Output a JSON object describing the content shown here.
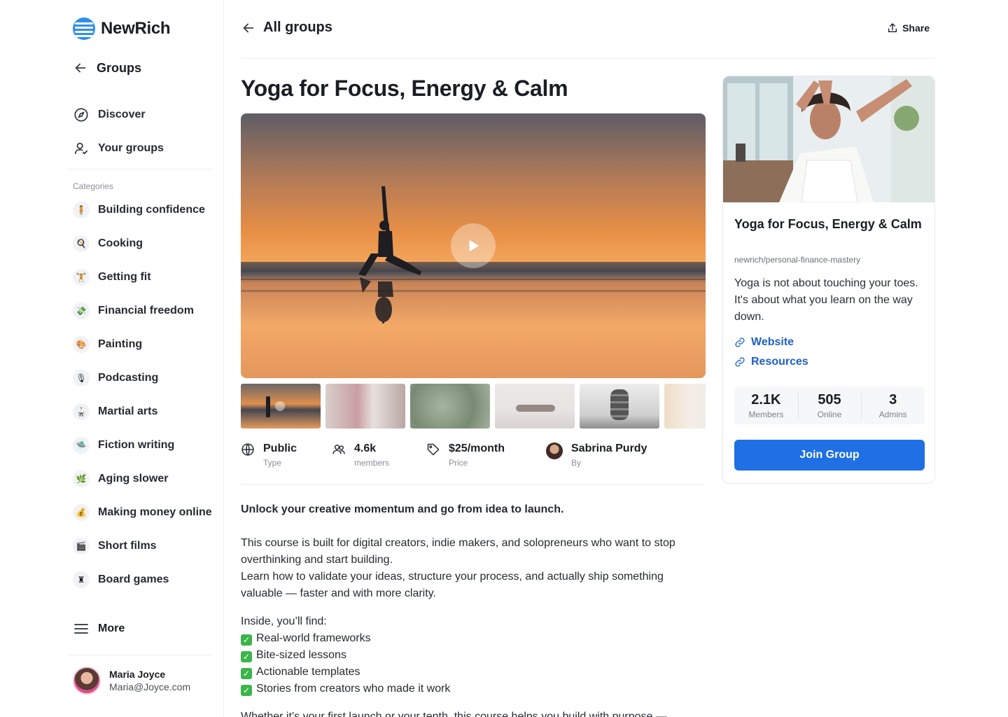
{
  "brand": {
    "name": "NewRich"
  },
  "sidebar": {
    "back_label": "Groups",
    "nav": [
      {
        "label": "Discover",
        "icon": "compass-icon"
      },
      {
        "label": "Your groups",
        "icon": "user-check-icon"
      }
    ],
    "categories_label": "Categories",
    "categories": [
      {
        "label": "Building confidence",
        "icon": "🧍"
      },
      {
        "label": "Cooking",
        "icon": "🍳"
      },
      {
        "label": "Getting fit",
        "icon": "🏋"
      },
      {
        "label": "Financial freedom",
        "icon": "💸"
      },
      {
        "label": "Painting",
        "icon": "🎨"
      },
      {
        "label": "Podcasting",
        "icon": "🎙"
      },
      {
        "label": "Martial arts",
        "icon": "🥋"
      },
      {
        "label": "Fiction writing",
        "icon": "🛸"
      },
      {
        "label": "Aging slower",
        "icon": "🌿"
      },
      {
        "label": "Making money online",
        "icon": "💰"
      },
      {
        "label": "Short films",
        "icon": "🎬"
      },
      {
        "label": "Board games",
        "icon": "♜"
      }
    ],
    "more_label": "More",
    "user": {
      "name": "Maria Joyce",
      "email": "Maria@Joyce.com"
    }
  },
  "header": {
    "back_label": "All groups",
    "share_label": "Share"
  },
  "group": {
    "title": "Yoga for Focus, Energy & Calm",
    "meta": [
      {
        "value": "Public",
        "label": "Type",
        "icon": "globe-icon"
      },
      {
        "value": "4.6k",
        "label": "members",
        "icon": "users-icon"
      },
      {
        "value": "$25/month",
        "label": "Price",
        "icon": "tag-icon"
      },
      {
        "value": "Sabrina Purdy",
        "label": "By",
        "icon": "creator-avatar"
      }
    ],
    "description": {
      "lead": "Unlock your creative momentum and go from idea to launch.",
      "para1": "This course is built for digital creators, indie makers, and solopreneurs who want to stop overthinking and start building.",
      "para2": "Learn how to validate your ideas, structure your process, and actually ship something valuable — faster and with more clarity.",
      "inside_label": "Inside, you’ll find:",
      "bullets": [
        "Real-world frameworks",
        "Bite-sized lessons",
        "Actionable templates",
        "Stories from creators who made it work"
      ],
      "closing": "Whether it’s your first launch or your tenth, this course helps you build with purpose —"
    }
  },
  "card": {
    "title": "Yoga for Focus, Energy & Calm",
    "slug": "newrich/personal-finance-mastery",
    "description": "Yoga is not about touching your toes. It's about what you learn on the way down.",
    "links": [
      {
        "label": "Website"
      },
      {
        "label": "Resources"
      }
    ],
    "stats": [
      {
        "value": "2.1K",
        "label": "Members"
      },
      {
        "value": "505",
        "label": "Online"
      },
      {
        "value": "3",
        "label": "Admins"
      }
    ],
    "join_label": "Join Group"
  },
  "colors": {
    "accent": "#1f6fe5",
    "link": "#1f5fc4",
    "brand": "#2e8fea"
  }
}
